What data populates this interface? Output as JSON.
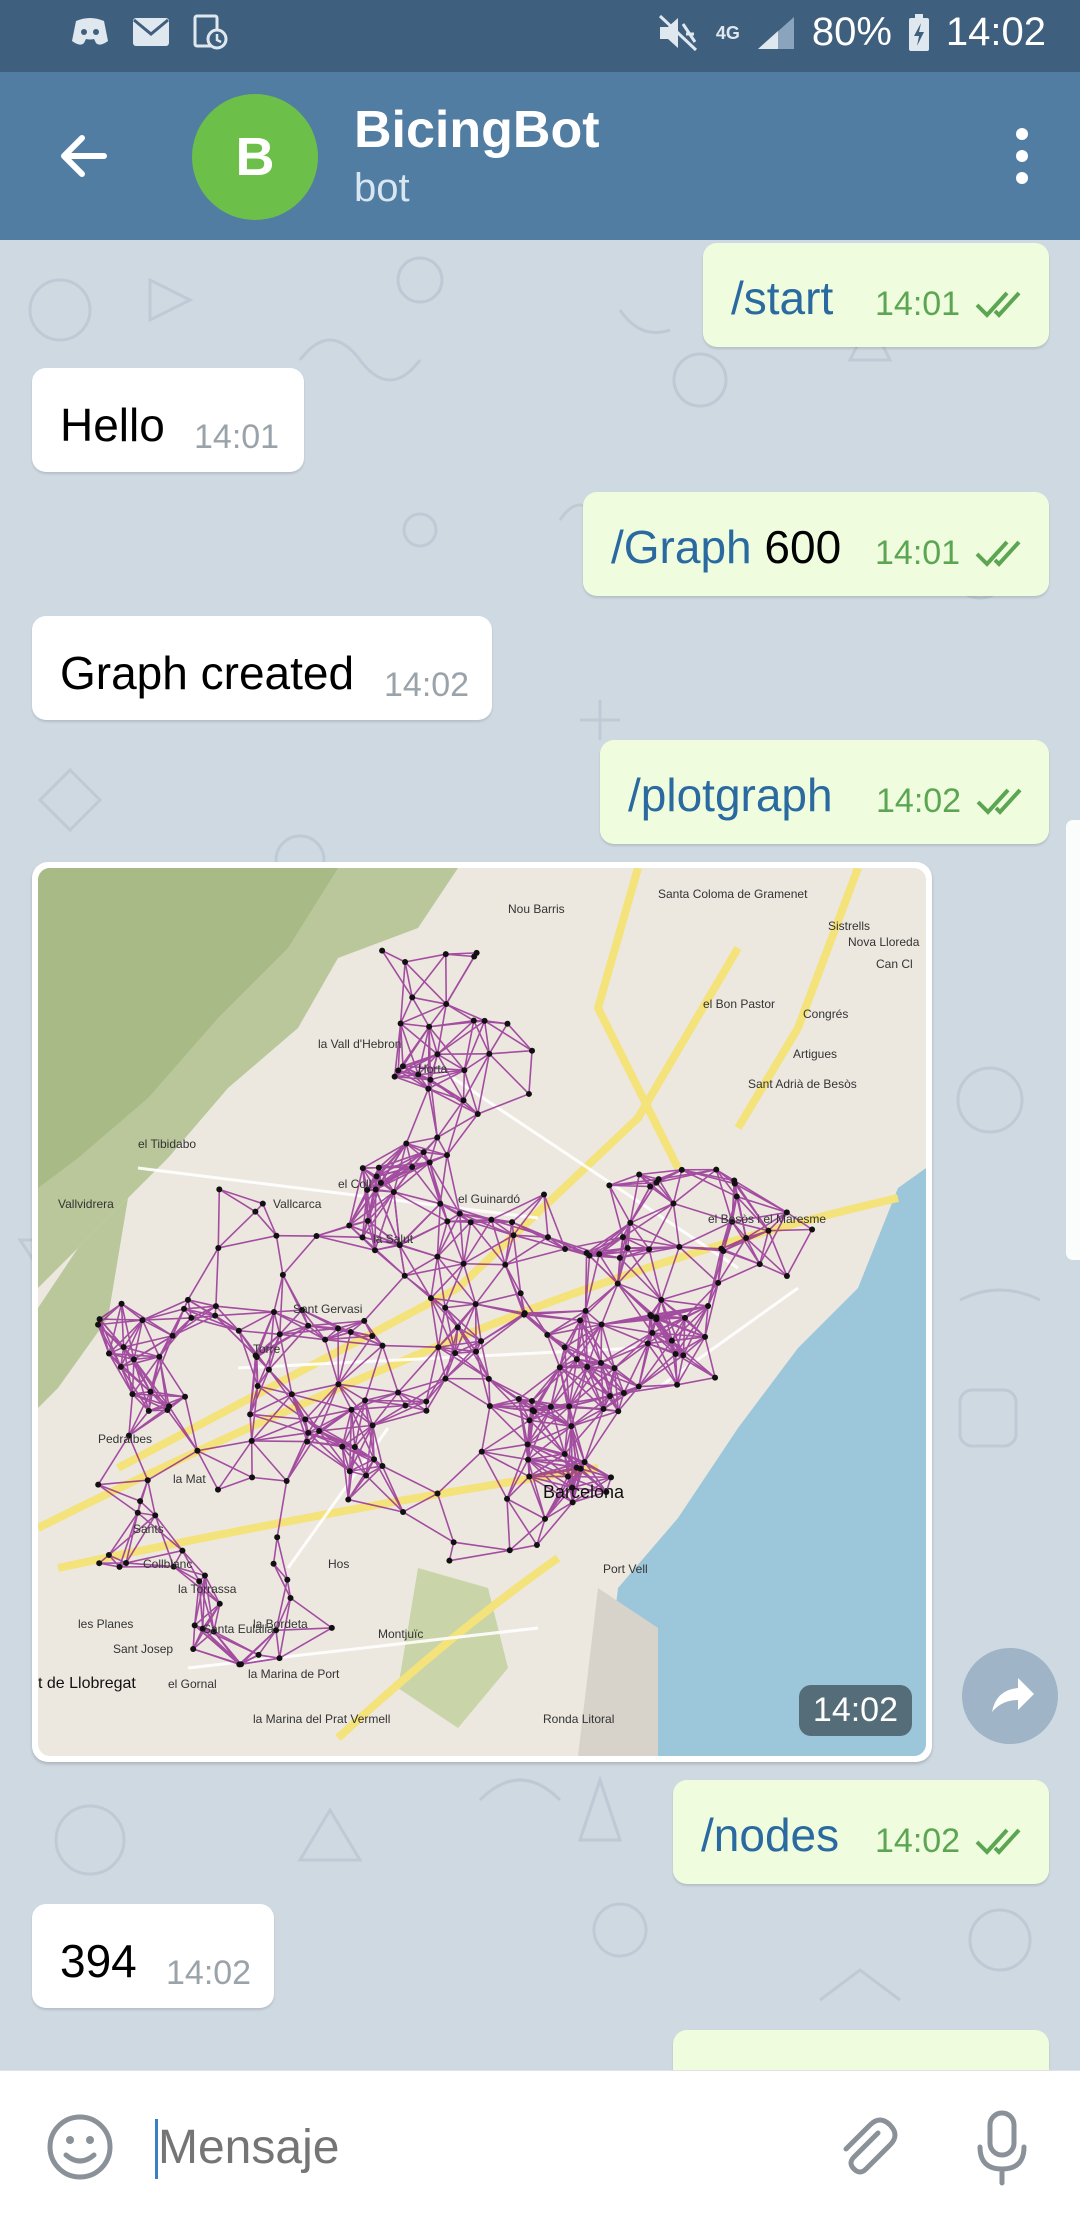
{
  "status_bar": {
    "battery": "80%",
    "time": "14:02",
    "network": "4G",
    "icons": [
      "discord-icon",
      "mail-icon",
      "download-icon",
      "mute-icon",
      "signal-icon",
      "battery-icon"
    ]
  },
  "header": {
    "title": "BicingBot",
    "subtitle": "bot",
    "avatar_letter": "B",
    "avatar_color": "#6cc04a"
  },
  "messages": [
    {
      "dir": "out",
      "cmd": "/start",
      "arg": "",
      "time": "14:01",
      "read": true
    },
    {
      "dir": "in",
      "text": "Hello",
      "time": "14:01"
    },
    {
      "dir": "out",
      "cmd": "/Graph",
      "arg": "600",
      "time": "14:01",
      "read": true
    },
    {
      "dir": "in",
      "text": "Graph created",
      "time": "14:02"
    },
    {
      "dir": "out",
      "cmd": "/plotgraph",
      "arg": "",
      "time": "14:02",
      "read": true
    },
    {
      "dir": "in",
      "type": "photo",
      "time": "14:02",
      "map_labels": [
        "Santa Coloma de Gramenet",
        "Nou Barris",
        "Sistrells",
        "Nova Lloreda",
        "Can Cl",
        "el Bon Pastor",
        "Congrés",
        "Artigues",
        "Sant Adrià de Besòs",
        "la Vall d'Hebron",
        "Horta",
        "el Tibidabo",
        "el Coll",
        "Vallvidrera",
        "Vallcarca",
        "el Guinardó",
        "la Salut",
        "el Besòs i el Maresme",
        "Sant Gervasi",
        "Torre",
        "Pedralbes",
        "Barcelona",
        "la Mat",
        "Port Vell",
        "Collblanc",
        "la Torrassa",
        "les Planes",
        "Santa Eulàlia",
        "Sant Josep",
        "la Bordeta",
        "Montjuïc",
        "t de Llobregat",
        "el Gornal",
        "la Marina de Port",
        "la Marina del Prat Vermell",
        "Ronda Litoral",
        "Hos",
        "Sants"
      ]
    },
    {
      "dir": "out",
      "cmd": "/nodes",
      "arg": "",
      "time": "14:02",
      "read": true
    },
    {
      "dir": "in",
      "text": "394",
      "time": "14:02"
    }
  ],
  "composer": {
    "placeholder": "Mensaje"
  },
  "colors": {
    "header": "#517da2",
    "status_bar": "#3f5f7e",
    "outgoing_bubble": "#effdde",
    "incoming_bubble": "#ffffff",
    "command_text": "#2a6aa0",
    "outgoing_time": "#5ca553",
    "graph_edges": "#8b1a8b"
  }
}
